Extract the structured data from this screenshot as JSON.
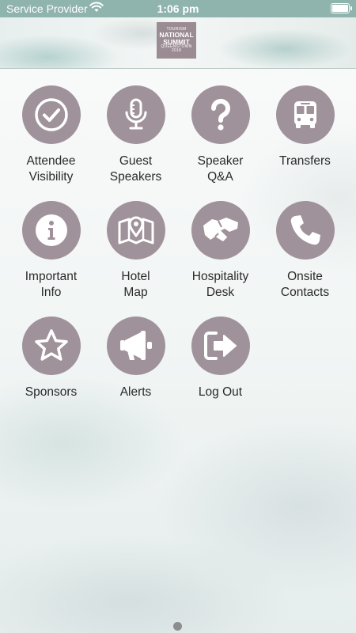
{
  "status_bar": {
    "carrier": "Service Provider",
    "time": "1:06 pm"
  },
  "logo": {
    "small": "QUEENSTOWN",
    "top": "TOURISM",
    "line1": "NATIONAL",
    "line2": "SUMMIT",
    "year": "2018"
  },
  "menu": [
    {
      "label": "Attendee\nVisibility",
      "icon": "check-circle-icon"
    },
    {
      "label": "Guest\nSpeakers",
      "icon": "microphone-icon"
    },
    {
      "label": "Speaker\nQ&A",
      "icon": "question-mark-icon"
    },
    {
      "label": "Transfers",
      "icon": "bus-icon"
    },
    {
      "label": "Important\nInfo",
      "icon": "info-icon"
    },
    {
      "label": "Hotel\nMap",
      "icon": "map-pin-icon"
    },
    {
      "label": "Hospitality\nDesk",
      "icon": "handshake-icon"
    },
    {
      "label": "Onsite\nContacts",
      "icon": "phone-icon"
    },
    {
      "label": "Sponsors",
      "icon": "star-icon"
    },
    {
      "label": "Alerts",
      "icon": "megaphone-icon"
    },
    {
      "label": "Log Out",
      "icon": "logout-icon"
    }
  ],
  "colors": {
    "icon_circle": "#a0929a",
    "status_bar": "#8fb3ad"
  }
}
